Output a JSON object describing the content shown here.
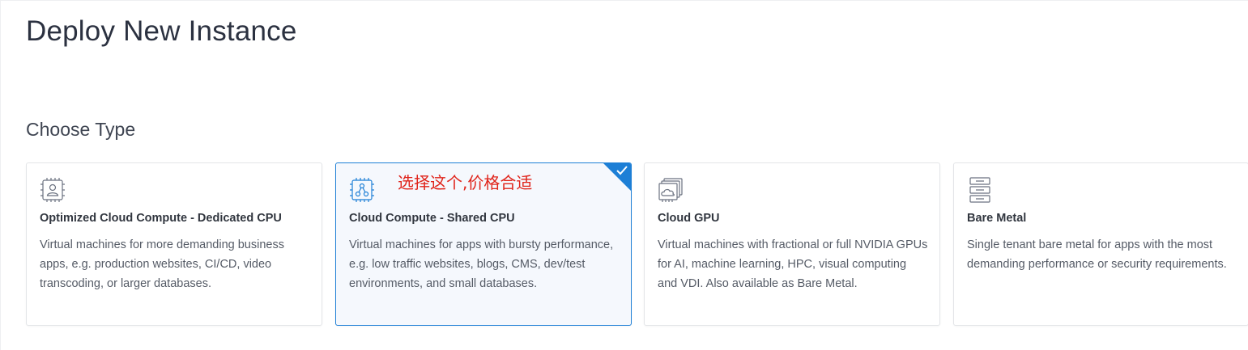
{
  "header": {
    "title": "Deploy New Instance"
  },
  "section": {
    "title": "Choose Type"
  },
  "cards": [
    {
      "name": "Optimized Cloud Compute - Dedicated CPU",
      "description": "Virtual machines for more demanding business apps, e.g. production websites, CI/CD, video transcoding, or larger databases.",
      "icon": "cpu-person-icon",
      "selected": false
    },
    {
      "name": "Cloud Compute - Shared CPU",
      "description": "Virtual machines for apps with bursty performance, e.g. low traffic websites, blogs, CMS, dev/test environments, and small databases.",
      "icon": "cpu-share-icon",
      "selected": true,
      "annotation": "选择这个,价格合适"
    },
    {
      "name": "Cloud GPU",
      "description": "Virtual machines with fractional or full NVIDIA GPUs for AI, machine learning, HPC, visual computing and VDI. Also available as Bare Metal.",
      "icon": "gpu-cloud-icon",
      "selected": false
    },
    {
      "name": "Bare Metal",
      "description": "Single tenant bare metal for apps with the most demanding performance or security requirements.",
      "icon": "server-stack-icon",
      "selected": false
    }
  ],
  "colors": {
    "accent": "#1d7fd6",
    "annotation": "#e0241b",
    "selected_bg": "#f5f8fd"
  }
}
